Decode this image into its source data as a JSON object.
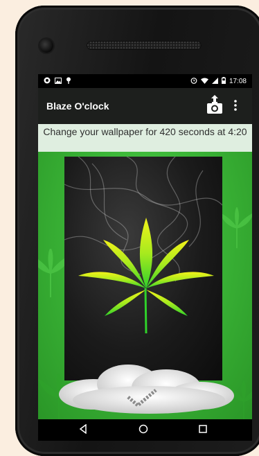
{
  "status_bar": {
    "time": "17:08",
    "left_icons": [
      "app-notification-icon",
      "image-icon",
      "pin-icon"
    ],
    "right_icons": [
      "alarm-icon",
      "wifi-icon",
      "signal-icon",
      "battery-icon"
    ]
  },
  "app_bar": {
    "title": "Blaze O'clock",
    "actions": [
      "camera-upload-icon",
      "more-vert-icon"
    ]
  },
  "banner": {
    "text": "Change your wallpaper for 420 seconds at 4:20"
  },
  "nav_bar": {
    "buttons": [
      "back-icon",
      "home-icon",
      "recents-icon"
    ]
  },
  "colors": {
    "accent_green": "#3bb537",
    "app_bar": "#1d1f1d",
    "banner_bg": "#dfeee0"
  }
}
